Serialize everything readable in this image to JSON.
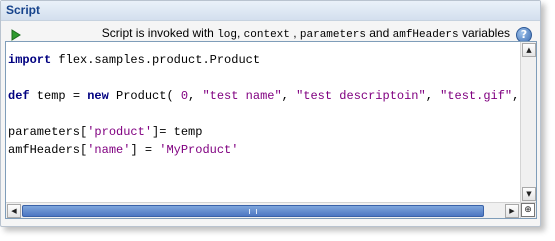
{
  "panel": {
    "title": "Script"
  },
  "toolbar": {
    "info_prefix": "Script is invoked with ",
    "var_log": "log",
    "sep1": ", ",
    "var_context": "context",
    "sep2": " , ",
    "var_parameters": "parameters",
    "sep3": " and ",
    "var_amfHeaders": "amfHeaders",
    "info_suffix": " variables",
    "help_label": "?",
    "run_icon": "play-icon"
  },
  "code": {
    "l1_kw": "import",
    "l1_rest": " flex.samples.product.Product",
    "l3_kw1": "def",
    "l3_a": " temp = ",
    "l3_kw2": "new",
    "l3_b": " Product( ",
    "l3_num": "0",
    "l3_c": ", ",
    "l3_s1": "\"test name\"",
    "l3_d": ", ",
    "l3_s2": "\"test descriptoin\"",
    "l3_e": ", ",
    "l3_s3": "\"test.gif\"",
    "l3_f": ", ",
    "l3_s4": "\"",
    "l5_a": "parameters[",
    "l5_s": "'product'",
    "l5_b": "]= temp",
    "l6_a": "amfHeaders[",
    "l6_s1": "'name'",
    "l6_b": "] = ",
    "l6_s2": "'MyProduct'"
  },
  "colors": {
    "keyword": "#000080",
    "string": "#800080",
    "title": "#15428b",
    "scroll_thumb": "#4c77c2"
  }
}
